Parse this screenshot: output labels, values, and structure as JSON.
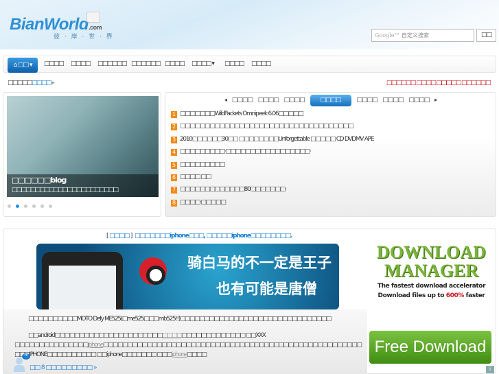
{
  "header": {
    "logo": "BianWorld",
    "logo_suffix": ".com",
    "logo_sub": "彼 · 岸 · 世 · 界",
    "search_brand": "Google™",
    "search_placeholder": "自定义搜索",
    "search_button": "□□"
  },
  "nav": {
    "home": "⌂ □□ ▾",
    "items": [
      "□□□□",
      "□□□□",
      "□□□□□□",
      "□□□□□□",
      "□□□□",
      "□□□□ ▾",
      "□□□□",
      "□□□□"
    ]
  },
  "breadcrumb": {
    "prefix": "□□□□□",
    "link": "□□□□",
    "arrow": "▸"
  },
  "hot_links": "□□□□□□ □□□□ □□□□□ □□□□□□",
  "slider": {
    "title": "□□□□□□blog",
    "desc": "□□□□□□□□□□□□□□□□□□□□□□□"
  },
  "news": {
    "tabs_left": [
      "□□□□",
      "□□□□",
      "□□□□"
    ],
    "active_tab": "□□□□",
    "tabs_right": [
      "□□□□",
      "□□□□",
      "□□□□"
    ],
    "items": [
      {
        "n": "1",
        "text": "□□□□□□□WildPackets Omnipeek 6.06□□□□□"
      },
      {
        "n": "2",
        "text": "□□□□□□□□□□□□□□□□□□□□□□□□□□□□□□□□□□□"
      },
      {
        "n": "3",
        "text": "2010□□□□□□30□□ □□□□□□□□Unforgettable □□□□□ CD DVDMV APE"
      },
      {
        "n": "4",
        "text": "□□□□□□□□□·□□□□□□□□□□□□□□□□□·"
      },
      {
        "n": "5",
        "text": "□□□□□□□□□"
      },
      {
        "n": "6",
        "text": "□□□□ □□"
      },
      {
        "n": "7",
        "text": "□□□□□□□□□□□□□80□□□□□□□·"
      },
      {
        "n": "8",
        "text": "□□□□·□□□□□"
      }
    ]
  },
  "article": {
    "category": "□□□□",
    "title": "□□□□□□□iphone□□□, □□□□□iphone□□□□□□□□.",
    "banner_line1": "骑白马的不一定是王子",
    "banner_line2": "也有可能是唐僧",
    "p1": "□□□□□□□□□□MOTO Defy ME525(□me525□□□mb525!!)□□□□□□□□□□□□□□□□□□□□□□□□□□□□□□□",
    "p2a": "□□android□□□□□□□□□□□□□□□□□□□□□□",
    "p2link1": "□□□□",
    "p2b": "□□□□□□□□□□□□□ □□XXX □□□□□□□□□□□□□□□",
    "p2link2": "iphone",
    "p2c": "□□□□□□□□□□□□□□□□□□□□□□□□□□□□□□□□□□□□□□□□□□□□□□□□□□□□□□□□IPHONE□□□□□□□□□□ □□iphone□□□□□□□ □□□",
    "p2link3": "iphone",
    "p2d": "□□□□",
    "comments": "□□ 8 □□□□□□□□□ »",
    "avatar_badge": "Hi"
  },
  "ad": {
    "line1": "DOWNLOAD",
    "line2": "MANAGER",
    "tag1": "The fastest download accelerator",
    "tag2_pre": "Download files up to ",
    "tag2_em": "600%",
    "tag2_post": " faster",
    "button": "Free Download",
    "info": "i"
  }
}
